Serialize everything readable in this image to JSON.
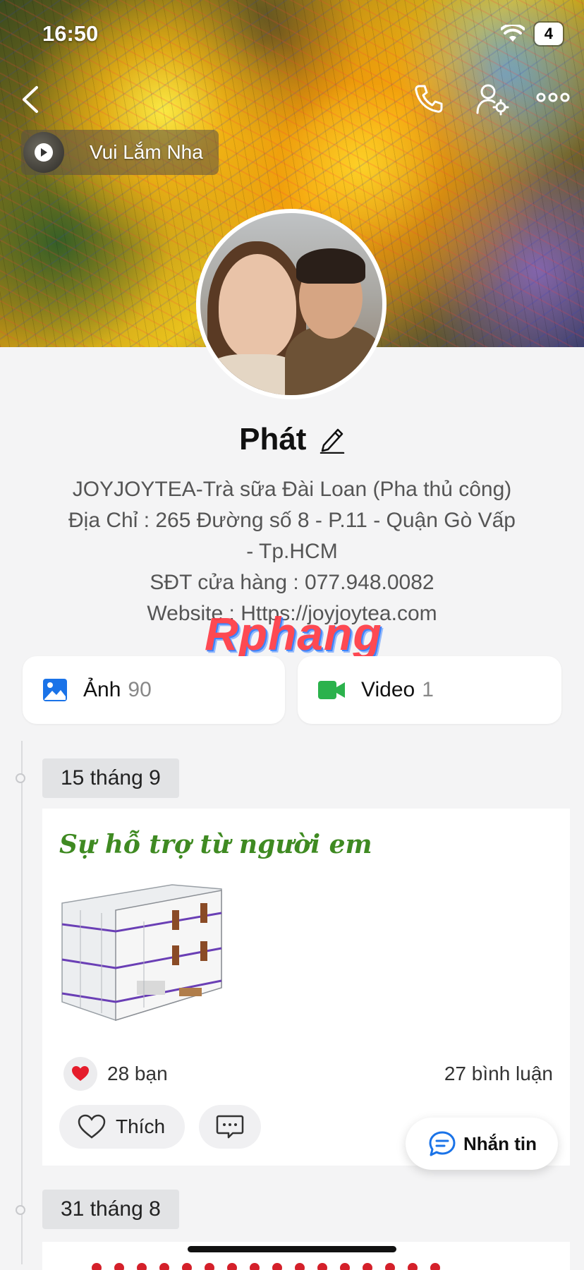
{
  "status_bar": {
    "time": "16:50",
    "battery": "4"
  },
  "nav": {
    "back_icon": "chevron-left-icon",
    "call_icon": "phone-icon",
    "friend_settings_icon": "user-gear-icon",
    "more_icon": "more-dots-icon"
  },
  "music": {
    "label": "Vui Lắm Nha",
    "icon": "play-icon"
  },
  "profile": {
    "name": "Phát",
    "bio_lines": [
      "JOYJOYTEA-Trà sữa Đài Loan (Pha thủ công)",
      "Địa Chỉ : 265 Đường số 8 - P.11 - Quận Gò Vấp",
      "- Tp.HCM",
      "SĐT cửa hàng : 077.948.0082",
      "Website : Https://joyjoytea.com"
    ]
  },
  "watermark": "Rphang",
  "media": {
    "photos": {
      "label": "Ảnh",
      "count": "90",
      "color": "#1a73e8"
    },
    "videos": {
      "label": "Video",
      "count": "1",
      "color": "#2bb24c"
    }
  },
  "timeline": [
    {
      "date": "15 tháng 9",
      "title": "Sự hỗ trợ từ người em",
      "title_color": "#3f8a22",
      "reactions": "28 bạn",
      "comments": "27 bình luận",
      "like_label": "Thích"
    },
    {
      "date": "31 tháng 8"
    }
  ],
  "message_button": {
    "label": "Nhắn tin"
  }
}
